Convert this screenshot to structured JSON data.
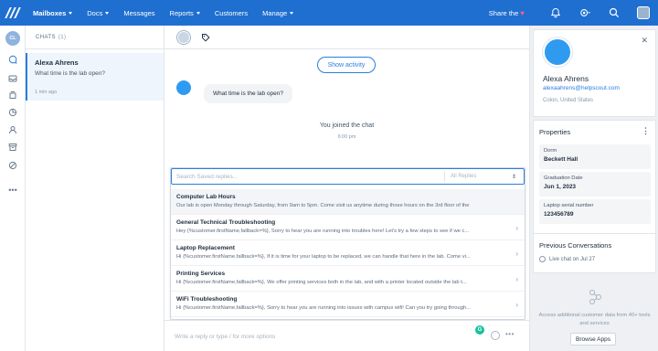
{
  "nav": {
    "items": [
      {
        "label": "Mailboxes",
        "dropdown": true,
        "active": true
      },
      {
        "label": "Docs",
        "dropdown": true,
        "active": false
      },
      {
        "label": "Messages",
        "dropdown": false,
        "active": false
      },
      {
        "label": "Reports",
        "dropdown": true,
        "active": false
      },
      {
        "label": "Customers",
        "dropdown": false,
        "active": false
      },
      {
        "label": "Manage",
        "dropdown": true,
        "active": false
      }
    ],
    "share_label": "Share the",
    "share_heart": "♥",
    "accent": "#1f6fd0"
  },
  "rail": {
    "user_initials": "CL"
  },
  "chats": {
    "header": "CHATS",
    "count": "(1)",
    "items": [
      {
        "name": "Alexa Ahrens",
        "message": "What time is the lab open?",
        "time": "1 min ago"
      }
    ]
  },
  "conversation": {
    "show_activity": "Show activity",
    "customer_message": "What time is the lab open?",
    "joined_text": "You joined the chat",
    "joined_time": "6:00 pm"
  },
  "saved_replies": {
    "search_placeholder": "Search Saved replies...",
    "filter_label": "All Replies",
    "items": [
      {
        "title": "Computer Lab Hours",
        "body": "Our lab is open Monday through Saturday, from 9am to 5pm. Come visit us anytime during those hours on the 3rd floor of the"
      },
      {
        "title": "General Technical Troubleshooting",
        "body": "Hey {%customer.firstName,fallback=%}, Sorry to hear you are running into troubles here! Let's try a few steps to see if we c..."
      },
      {
        "title": "Laptop Replacement",
        "body": "Hi {%customer.firstName,fallback=%}, If it is time for your laptop to be replaced, we can handle that here in the lab. Come vi..."
      },
      {
        "title": "Printing Services",
        "body": "Hi {%customer.firstName,fallback=%}, We offer printing services both in the lab, and with a printer located outside the lab t..."
      },
      {
        "title": "WiFi Troubleshooting",
        "body": "Hi {%customer.firstName,fallback=%}, Sorry to hear you are running into issues with campus wifi! Can you try going through..."
      }
    ]
  },
  "composer": {
    "placeholder": "Write a reply or type / for more options",
    "grammarly": "G",
    "more": "•••"
  },
  "customer": {
    "name": "Alexa Ahrens",
    "email": "alexaahrens@helpscout.com",
    "location": "Colon, United States"
  },
  "properties": {
    "title": "Properties",
    "items": [
      {
        "label": "Dorm",
        "value": "Beckett Hall"
      },
      {
        "label": "Graduation Date",
        "value": "Jun 1, 2023"
      },
      {
        "label": "Laptop serial number",
        "value": "123456789"
      }
    ]
  },
  "previous": {
    "title": "Previous Conversations",
    "item": "Live chat on Jul 27"
  },
  "apps": {
    "text": "Access additional customer data from 40+ tools and services",
    "button": "Browse Apps"
  }
}
